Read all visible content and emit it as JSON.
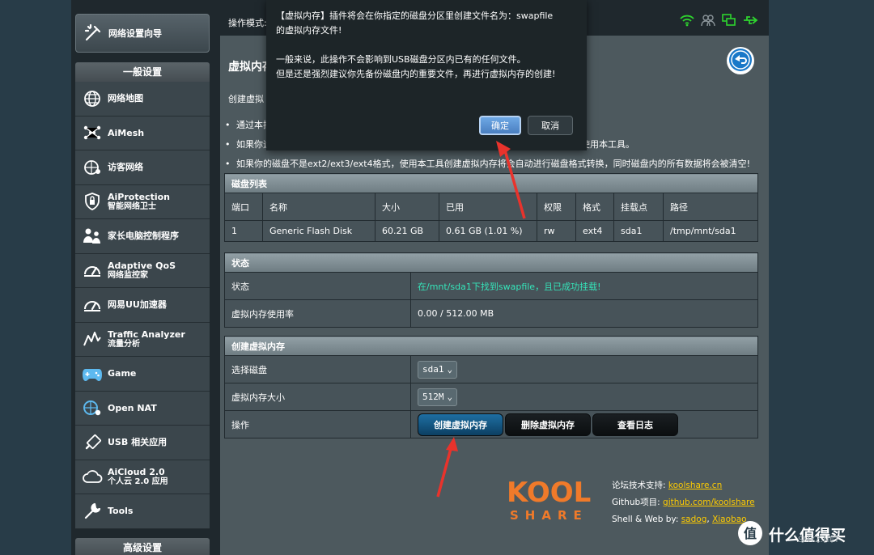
{
  "topbar": {
    "mode_label": "操作模式:"
  },
  "sidebar": {
    "wizard_label": "网络设置向导",
    "general_header": "一般设置",
    "advanced_header": "高级设置",
    "items": [
      {
        "line1": "网络地图",
        "line2": ""
      },
      {
        "line1": "AiMesh",
        "line2": ""
      },
      {
        "line1": "访客网络",
        "line2": ""
      },
      {
        "line1": "AiProtection",
        "line2": "智能网络卫士"
      },
      {
        "line1": "家长电脑控制程序",
        "line2": ""
      },
      {
        "line1": "Adaptive QoS",
        "line2": "网络监控家"
      },
      {
        "line1": "网易UU加速器",
        "line2": ""
      },
      {
        "line1": "Traffic Analyzer",
        "line2": "流量分析"
      },
      {
        "line1": "Game",
        "line2": ""
      },
      {
        "line1": "Open NAT",
        "line2": ""
      },
      {
        "line1": "USB 相关应用",
        "line2": ""
      },
      {
        "line1": "AiCloud 2.0",
        "line2": "个人云 2.0 应用"
      },
      {
        "line1": "Tools",
        "line2": ""
      }
    ]
  },
  "main": {
    "title": "虚拟内存",
    "desc": "创建虚拟",
    "bullets": [
      "通过本插",
      "如果你运",
      "如果你的磁盘不是ext2/ext3/ext4格式，使用本工具创建虚拟内存将会自动进行磁盘格式转换，同时磁盘内的所有数据将会被清空!"
    ],
    "bullet2_tail": "使用本工具。"
  },
  "disk_table": {
    "header": "磁盘列表",
    "columns": [
      "端口",
      "名称",
      "大小",
      "已用",
      "权限",
      "格式",
      "挂载点",
      "路径"
    ],
    "rows": [
      [
        "1",
        "Generic Flash Disk",
        "60.21 GB",
        "0.61 GB (1.01 %)",
        "rw",
        "ext4",
        "sda1",
        "/tmp/mnt/sda1"
      ]
    ]
  },
  "status_table": {
    "header": "状态",
    "rows": [
      {
        "label": "状态",
        "value": "在/mnt/sda1下找到swapfile，且已成功挂载!"
      },
      {
        "label": "虚拟内存使用率",
        "value": "0.00 / 512.00 MB"
      }
    ]
  },
  "create_table": {
    "header": "创建虚拟内存",
    "disk_label": "选择磁盘",
    "disk_value": "sda1",
    "size_label": "虚拟内存大小",
    "size_value": "512M",
    "action_label": "操作",
    "btn_create": "创建虚拟内存",
    "btn_delete": "删除虚拟内存",
    "btn_log": "查看日志"
  },
  "footer": {
    "forum_label": "论坛技术支持:",
    "forum_link": "koolshare.cn",
    "github_label": "Github项目:",
    "github_link": "github.com/koolshare",
    "shell_label": "Shell & Web by:",
    "author1": "sadog",
    "sep": ",",
    "author2": "Xiaobao",
    "logo_top": "KOOL",
    "logo_bottom": "SHARE"
  },
  "dialog": {
    "line1": "【虚拟内存】插件将会在你指定的磁盘分区里创建文件名为：swapfile",
    "line2": "的虚拟内存文件!",
    "line3": "一般来说，此操作不会影响到USB磁盘分区内已有的任何文件。",
    "line4": "但是还是强烈建议你先备份磁盘内的重要文件，再进行虚拟内存的创建!",
    "confirm": "确定",
    "cancel": "取消"
  },
  "watermark": {
    "text": "什么值得买",
    "sub": "SMYZ.NET"
  },
  "colors": {
    "accent_green": "#35e5ba",
    "link_yellow": "#ffcc00",
    "arrow_red": "#e8332c",
    "logo_orange": "#f07a2a"
  }
}
